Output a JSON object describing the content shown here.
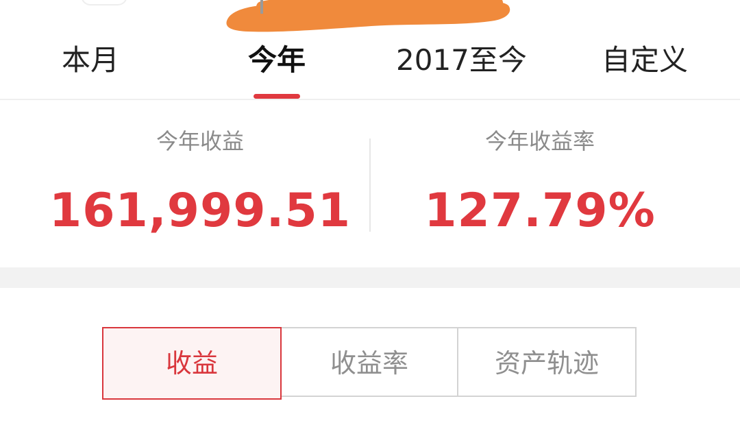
{
  "tabs": {
    "month": "本月",
    "year": "今年",
    "since2017": "2017至今",
    "custom": "自定义",
    "active": "今年"
  },
  "summary": {
    "profit_label": "今年收益",
    "profit_value": "161,999.51",
    "rate_label": "今年收益率",
    "rate_value": "127.79%"
  },
  "segments": {
    "profit": "收益",
    "rate": "收益率",
    "assets": "资产轨迹",
    "active": "收益"
  },
  "colors": {
    "accent": "#e0393f",
    "redaction": "#f08a3c",
    "active_segment_bg": "#fdf3f3"
  },
  "icons": {
    "logo": "brand-logo-icon"
  }
}
